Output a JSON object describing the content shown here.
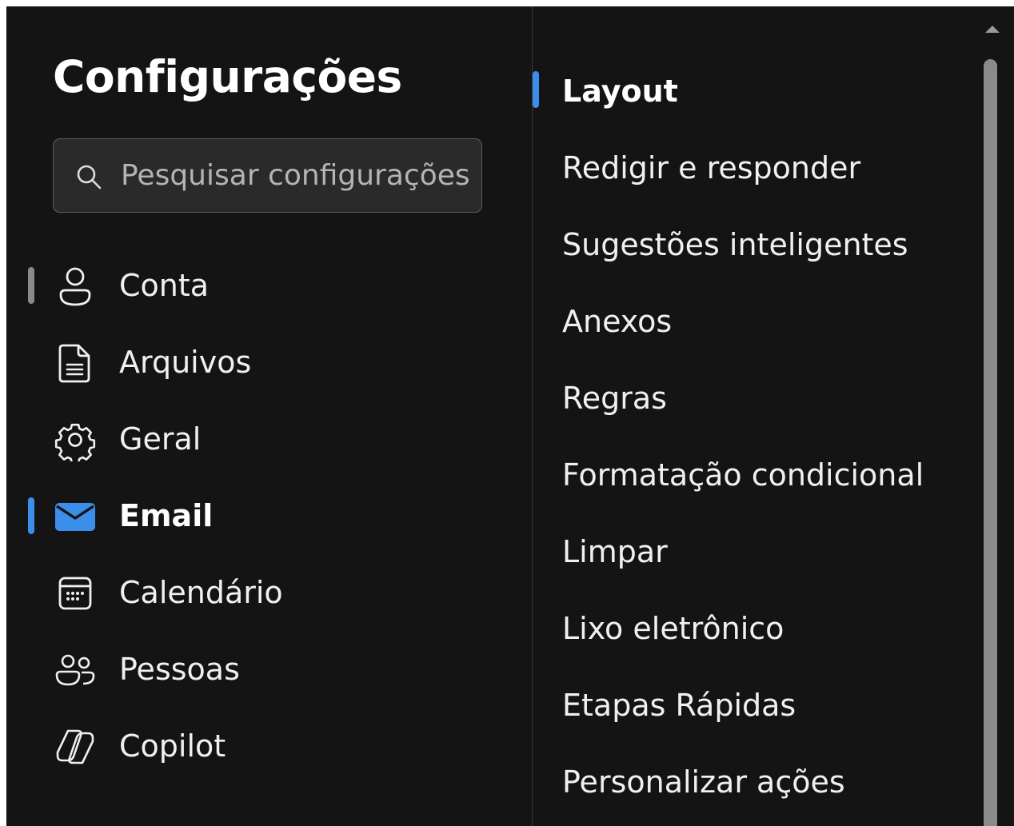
{
  "page": {
    "title": "Configurações"
  },
  "search": {
    "placeholder": "Pesquisar configurações"
  },
  "accent": "#3b8eea",
  "nav": {
    "items": [
      {
        "label": "Conta",
        "icon": "person-icon"
      },
      {
        "label": "Arquivos",
        "icon": "document-icon"
      },
      {
        "label": "Geral",
        "icon": "gear-icon"
      },
      {
        "label": "Email",
        "icon": "mail-icon",
        "selected": true
      },
      {
        "label": "Calendário",
        "icon": "calendar-icon"
      },
      {
        "label": "Pessoas",
        "icon": "people-icon"
      },
      {
        "label": "Copilot",
        "icon": "copilot-icon"
      }
    ]
  },
  "sub": {
    "items": [
      {
        "label": "Layout",
        "selected": true
      },
      {
        "label": "Redigir e responder"
      },
      {
        "label": "Sugestões inteligentes"
      },
      {
        "label": "Anexos"
      },
      {
        "label": "Regras"
      },
      {
        "label": "Formatação condicional"
      },
      {
        "label": "Limpar"
      },
      {
        "label": "Lixo eletrônico"
      },
      {
        "label": "Etapas Rápidas"
      },
      {
        "label": "Personalizar ações"
      }
    ]
  }
}
